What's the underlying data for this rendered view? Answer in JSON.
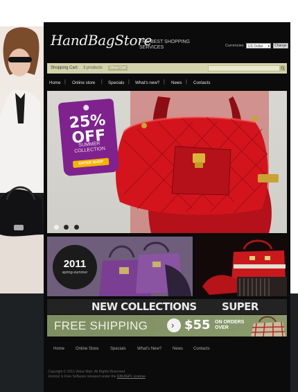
{
  "header": {
    "logo_text": "HandBagStore",
    "tagline": "THE BEST SHOPPING SERVICES",
    "currency_label": "Currencies",
    "currency_value": "US Dollar",
    "change_button": "Change"
  },
  "cart": {
    "label": "Shopping Cart:",
    "count": "3 products",
    "show_button": "Show Cart"
  },
  "nav": {
    "items": [
      "Home",
      "Online store",
      "Specials",
      "What's new?",
      "News",
      "Contacts"
    ]
  },
  "hero": {
    "discount": "25%",
    "discount_word": "OFF",
    "collection_line1": "SUMMER",
    "collection_line2": "COLLECTION",
    "cta": "ENTER SHOP",
    "slides": 3,
    "active_slide": 1
  },
  "promo": {
    "year": "2011",
    "season": "spring-summer",
    "new_collections": "NEW COLLECTIONS",
    "super_sale": "SUPER SALE",
    "free_shipping": "FREE SHIPPING",
    "price": "$55",
    "on_orders_line1": "ON ORDERS",
    "on_orders_line2": "OVER"
  },
  "footer": {
    "nav": [
      "Home",
      "Online Store",
      "Specials",
      "What's New?",
      "News",
      "Contacts"
    ],
    "copyright_line1": "Copyright © 2011 Virtue Mart. All Rights Reserved.",
    "copyright_line2": "Joomla! is Free Software released under the",
    "license_link": "GNU/GPL License"
  },
  "colors": {
    "cart_bar": "#d5d3ab",
    "badge": "#7f228e",
    "shipping_band": "#7e8e62",
    "page_bg": "#0b0b0b"
  }
}
